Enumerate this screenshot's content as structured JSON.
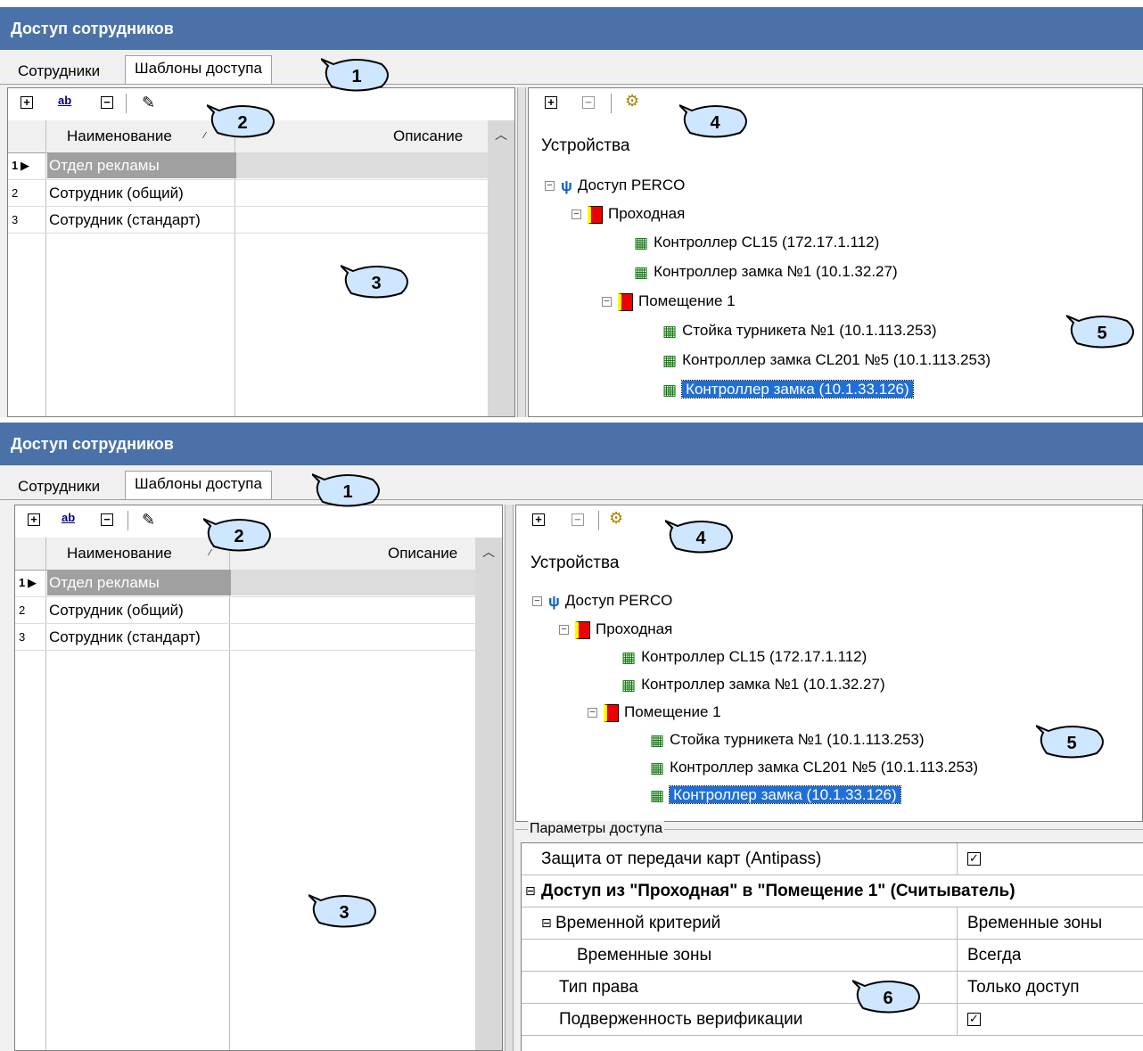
{
  "top": {
    "window_title": "Доступ сотрудников",
    "tabs": [
      "Сотрудники",
      "Шаблоны доступа"
    ],
    "grid_headers": {
      "name": "Наименование",
      "desc": "Описание"
    },
    "rows": [
      {
        "num": "1",
        "name": "Отдел рекламы"
      },
      {
        "num": "2",
        "name": "Сотрудник (общий)"
      },
      {
        "num": "3",
        "name": "Сотрудник (стандарт)"
      }
    ],
    "tree_title": "Устройства",
    "tree": {
      "root": "Доступ PERCO",
      "l1": "Проходная",
      "c1": "Контроллер CL15 (172.17.1.112)",
      "c2": "Контроллер замка №1 (10.1.32.27)",
      "room": "Помещение 1",
      "r1": "Стойка турникета №1 (10.1.113.253)",
      "r2": "Контроллер замка CL201 №5 (10.1.113.253)",
      "r3": "Контроллер замка (10.1.33.126)"
    },
    "callouts": [
      "1",
      "2",
      "3",
      "4",
      "5"
    ]
  },
  "bottom": {
    "window_title": "Доступ сотрудников",
    "tabs": [
      "Сотрудники",
      "Шаблоны доступа"
    ],
    "grid_headers": {
      "name": "Наименование",
      "desc": "Описание"
    },
    "rows": [
      {
        "num": "1",
        "name": "Отдел рекламы"
      },
      {
        "num": "2",
        "name": "Сотрудник (общий)"
      },
      {
        "num": "3",
        "name": "Сотрудник (стандарт)"
      }
    ],
    "tree_title": "Устройства",
    "tree": {
      "root": "Доступ PERCO",
      "l1": "Проходная",
      "c1": "Контроллер CL15 (172.17.1.112)",
      "c2": "Контроллер замка №1 (10.1.32.27)",
      "room": "Помещение 1",
      "r1": "Стойка турникета №1 (10.1.113.253)",
      "r2": "Контроллер замка CL201 №5 (10.1.113.253)",
      "r3": "Контроллер замка (10.1.33.126)"
    },
    "params": {
      "group_title": "Параметры доступа",
      "antipass_label": "Защита от передачи карт (Antipass)",
      "access_group": "Доступ из \"Проходная\" в \"Помещение 1\" (Считыватель)",
      "time_criterion": "Временной критерий",
      "time_criterion_value": "Временные зоны",
      "time_zones": "Временные зоны",
      "time_zones_value": "Всегда",
      "right_type": "Тип права",
      "right_type_value": "Только доступ",
      "verification": "Подверженность верификации"
    },
    "callouts": [
      "1",
      "2",
      "3",
      "4",
      "5",
      "6"
    ]
  },
  "colors": {
    "title_bar": "#4a72a8",
    "selection": "#1f6fd6",
    "row_selected": "#a0a0a0"
  }
}
